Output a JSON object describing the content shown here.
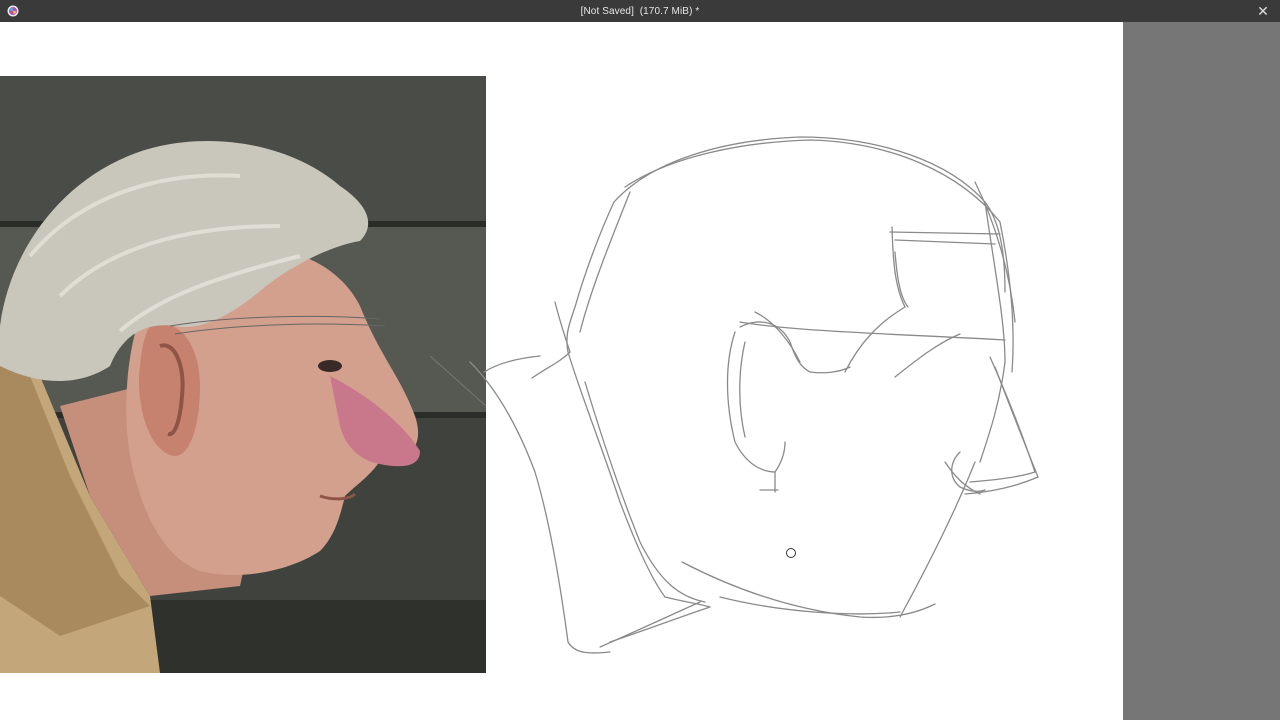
{
  "window": {
    "title": "[Not Saved]  (170.7 MiB) *",
    "close_label": "✕"
  },
  "canvas": {
    "reference_image_icon": "portrait-reference",
    "sketch_icon": "pencil-sketch-lines"
  },
  "colors": {
    "titlebar": "#3a3a3a",
    "canvas": "#ffffff",
    "sidepanel": "#767676",
    "sketch_stroke": "#8a8a8a"
  }
}
